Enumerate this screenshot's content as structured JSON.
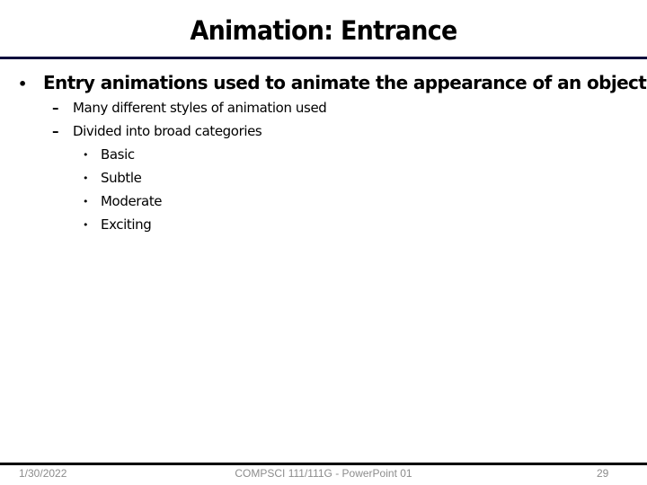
{
  "slide": {
    "title": "Animation: Entrance",
    "colors": {
      "title_rule": "#0a0a3c",
      "footer_rule": "#000000",
      "footer_text": "#8c8c8c"
    },
    "bullets": [
      {
        "level": 1,
        "marker": "•",
        "text": "Entry animations used to animate the appearance of an object"
      },
      {
        "level": 2,
        "marker": "–",
        "text": "Many different styles of animation used"
      },
      {
        "level": 2,
        "marker": "–",
        "text": "Divided into broad categories"
      },
      {
        "level": 3,
        "marker": "•",
        "text": "Basic"
      },
      {
        "level": 3,
        "marker": "•",
        "text": "Subtle"
      },
      {
        "level": 3,
        "marker": "•",
        "text": "Moderate"
      },
      {
        "level": 3,
        "marker": "•",
        "text": "Exciting"
      }
    ]
  },
  "footer": {
    "date": "1/30/2022",
    "center": "COMPSCI 111/111G - PowerPoint 01",
    "page_number": "29"
  }
}
